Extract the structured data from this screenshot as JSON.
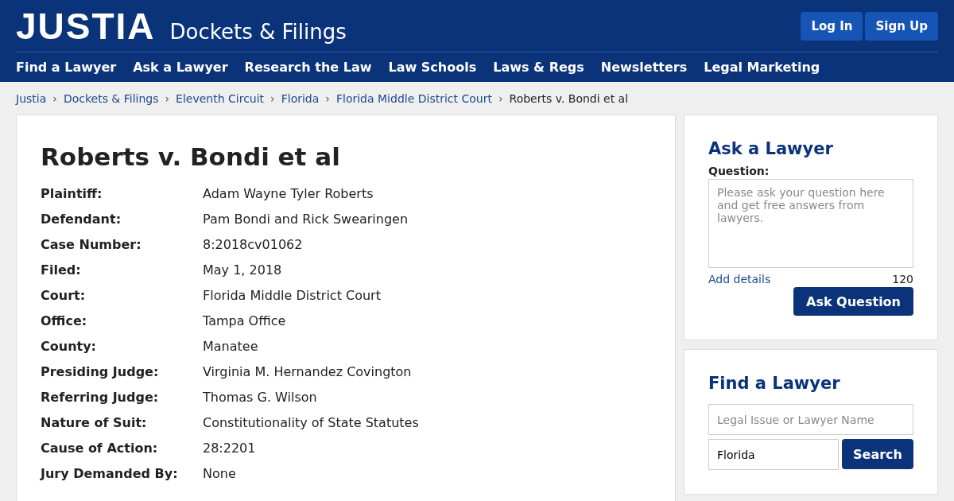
{
  "header": {
    "logo": "JUSTIA",
    "section": "Dockets & Filings",
    "buttons": [
      "Log In",
      "Sign Up"
    ]
  },
  "nav": [
    "Find a Lawyer",
    "Ask a Lawyer",
    "Research the Law",
    "Law Schools",
    "Laws & Regs",
    "Newsletters",
    "Legal Marketing"
  ],
  "breadcrumbs": [
    {
      "label": "Justia",
      "link": true
    },
    {
      "separator": "›",
      "label": "Dockets & Filings",
      "link": true
    },
    {
      "separator": "›",
      "label": "Eleventh Circuit",
      "link": true
    },
    {
      "separator": "›",
      "label": "Florida",
      "link": true
    },
    {
      "separator": "›",
      "label": "Florida Middle District Court",
      "link": true
    },
    {
      "separator": "›",
      "label": "Roberts v. Bondi et al",
      "link": false
    }
  ],
  "case": {
    "title": "Roberts v. Bondi et al",
    "fields": [
      {
        "label": "Plaintiff:",
        "value": "Adam Wayne Tyler Roberts"
      },
      {
        "label": "Defendant:",
        "value": "Pam Bondi and Rick Swearingen"
      },
      {
        "label": "Case Number:",
        "value": "8:2018cv01062"
      },
      {
        "label": "Filed:",
        "value": "May 1, 2018"
      },
      {
        "label": "Court:",
        "value": "Florida Middle District Court"
      },
      {
        "label": "Office:",
        "value": "Tampa Office"
      },
      {
        "label": "County:",
        "value": "Manatee"
      },
      {
        "label": "Presiding Judge:",
        "value": "Virginia M. Hernandez Covington"
      },
      {
        "label": "Referring Judge:",
        "value": "Thomas G. Wilson"
      },
      {
        "label": "Nature of Suit:",
        "value": "Constitutionality of State Statutes"
      },
      {
        "label": "Cause of Action:",
        "value": "28:2201"
      },
      {
        "label": "Jury Demanded By:",
        "value": "None"
      }
    ]
  },
  "ask_lawyer": {
    "title": "Ask a Lawyer",
    "question_label": "Question:",
    "placeholder": "Please ask your question here and get free answers from lawyers.",
    "add_details": "Add details",
    "count": "120",
    "button": "Ask Question"
  },
  "find_lawyer": {
    "title": "Find a Lawyer",
    "search": {
      "placeholder": "Legal Issue or Lawyer Name"
    },
    "location": {
      "value": "Florida"
    },
    "button": "Search"
  }
}
